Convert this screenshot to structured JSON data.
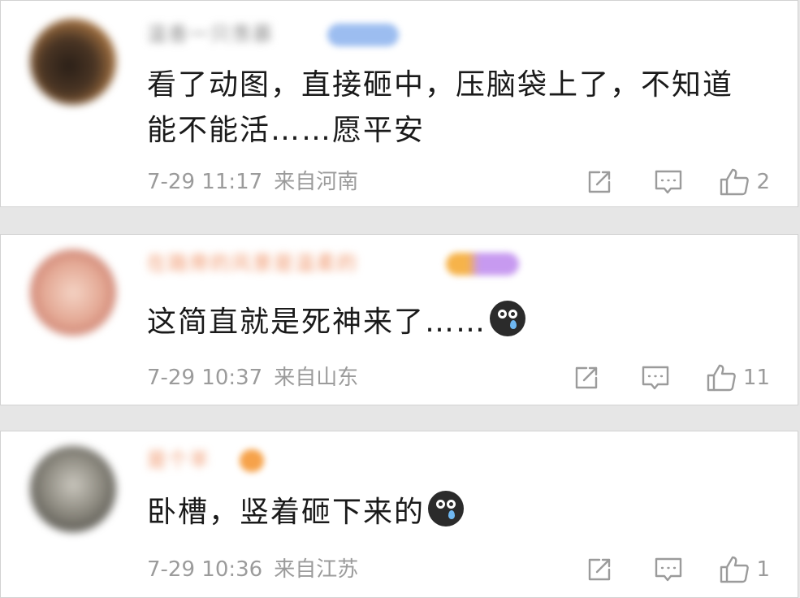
{
  "comments": [
    {
      "username": "温香一只羡慕",
      "text": "看了动图，直接砸中，压脑袋上了，不知道能不能活……愿平安",
      "has_emoji": false,
      "date": "7-29 11:17",
      "location": "来自河南",
      "likes": "2"
    },
    {
      "username": "在路旁的风景是温柔的",
      "text": "这简直就是死神来了……",
      "has_emoji": true,
      "date": "7-29 10:37",
      "location": "来自山东",
      "likes": "11"
    },
    {
      "username": "是个羊",
      "text": "卧槽，竖着砸下来的",
      "has_emoji": true,
      "date": "7-29 10:36",
      "location": "来自江苏",
      "likes": "1"
    }
  ],
  "icons": {
    "share": "share-icon",
    "reply": "comment-icon",
    "like": "thumbs-up-icon",
    "emoji": "crying-face-emoji"
  },
  "colors": {
    "text": "#1a1a1a",
    "meta": "#9b9b9b",
    "username_gray": "#8a8a8a",
    "username_orange": "#f0956a",
    "badge_blue": "#9cbdf0"
  }
}
